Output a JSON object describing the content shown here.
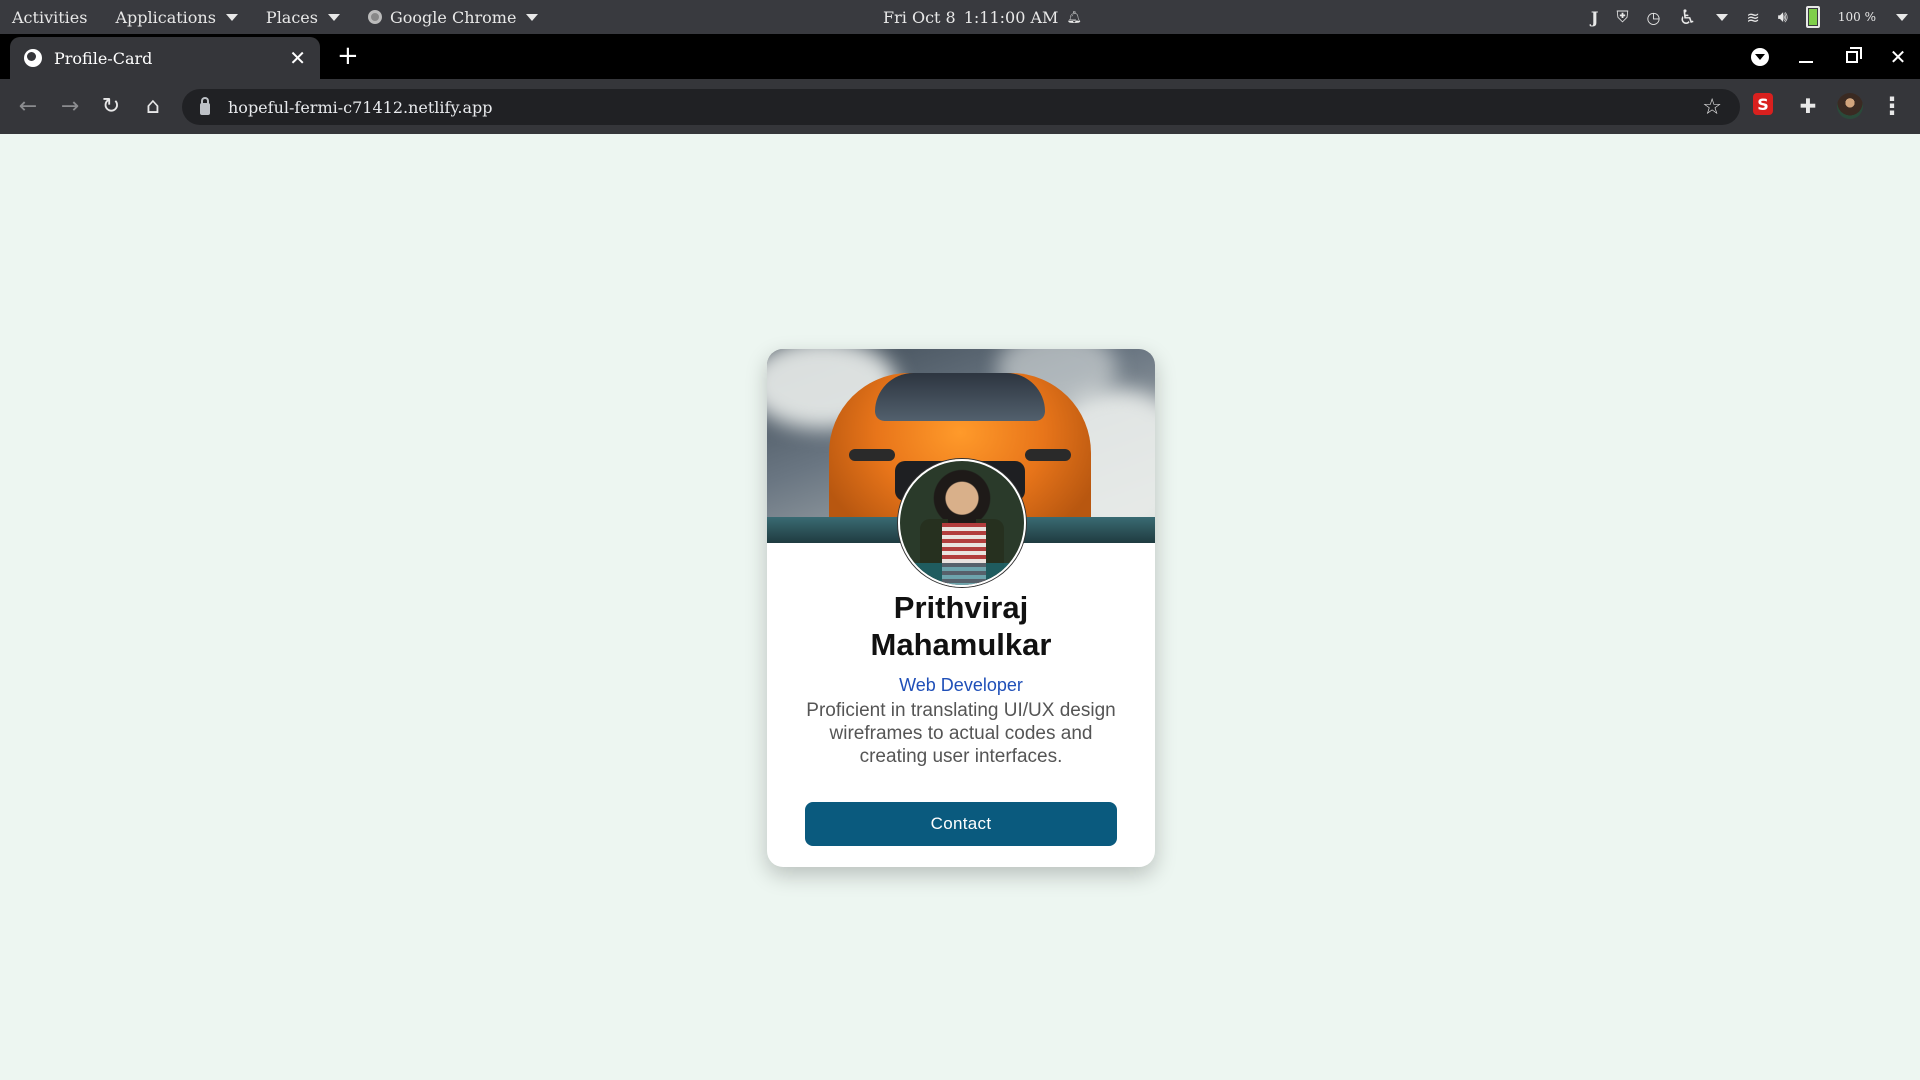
{
  "topbar": {
    "activities": "Activities",
    "applications": "Applications",
    "places": "Places",
    "app_name": "Google Chrome",
    "date": "Fri Oct 8",
    "time": "1:11:00 AM",
    "battery": "100 %"
  },
  "tabs": [
    {
      "title": "Profile-Card"
    }
  ],
  "toolbar": {
    "url": "hopeful-fermi-c71412.netlify.app",
    "extension_s_label": "S"
  },
  "card": {
    "name_line1": "Prithviraj",
    "name_line2": "Mahamulkar",
    "role": "Web Developer",
    "bio": "Proficient in translating UI/UX design wireframes to actual codes and creating user interfaces.",
    "contact_label": "Contact"
  },
  "colors": {
    "page_background": "#edf6f1",
    "role_text": "#1f4fb8",
    "button_background": "#0a5a7e",
    "car_orange": "#e8751a"
  },
  "icons": {
    "back": "arrow-left-icon",
    "forward": "arrow-right-icon",
    "reload": "reload-icon",
    "home": "home-icon",
    "lock": "lock-icon",
    "bookmark": "star-icon",
    "extensions": "puzzle-icon",
    "menu": "kebab-menu-icon"
  }
}
